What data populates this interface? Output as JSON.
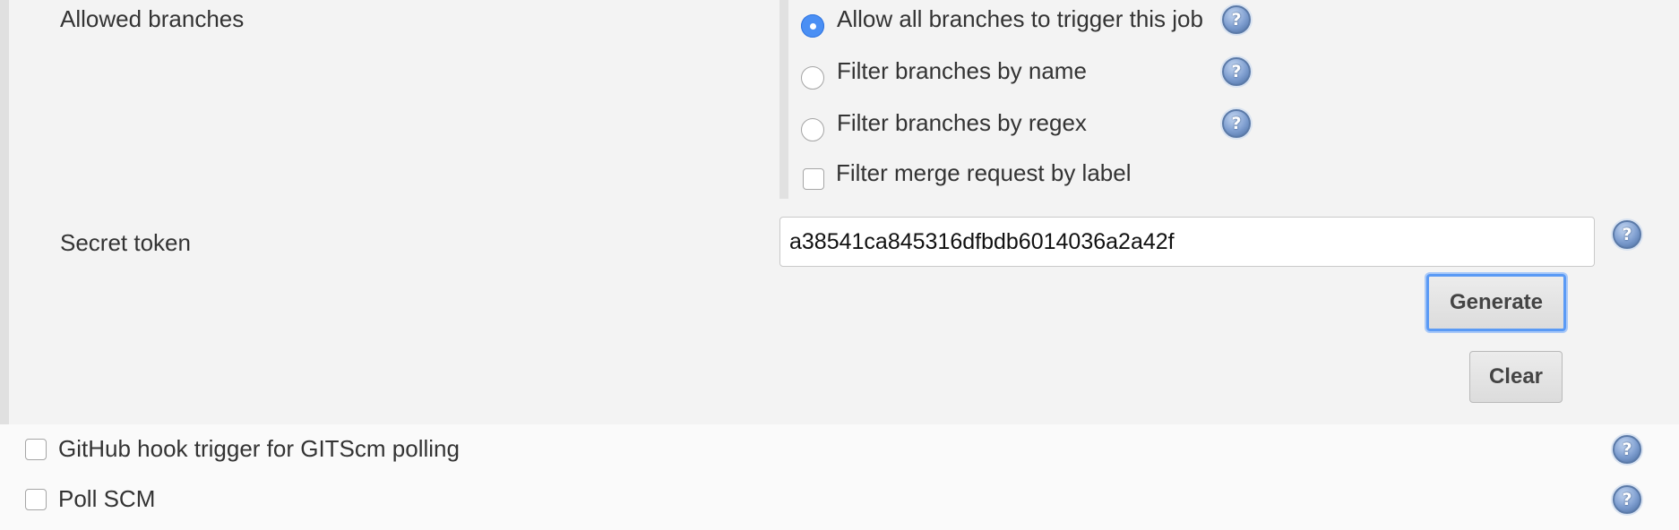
{
  "allowed_branches": {
    "label": "Allowed branches",
    "options": [
      {
        "label": "Allow all branches to trigger this job",
        "selected": true
      },
      {
        "label": "Filter branches by name",
        "selected": false
      },
      {
        "label": "Filter branches by regex",
        "selected": false
      }
    ],
    "merge_request_filter": {
      "label": "Filter merge request by label",
      "checked": false
    }
  },
  "secret_token": {
    "label": "Secret token",
    "value": "a38541ca845316dfbdb6014036a2a42f",
    "generate_label": "Generate",
    "clear_label": "Clear"
  },
  "triggers": [
    {
      "label": "GitHub hook trigger for GITScm polling",
      "checked": false
    },
    {
      "label": "Poll SCM",
      "checked": false
    }
  ],
  "icons": {
    "help": "help-icon",
    "help_glyph": "?"
  },
  "colors": {
    "accent": "#4a8ff4",
    "panel_background": "#f3f3f3",
    "page_background": "#fafafa"
  }
}
